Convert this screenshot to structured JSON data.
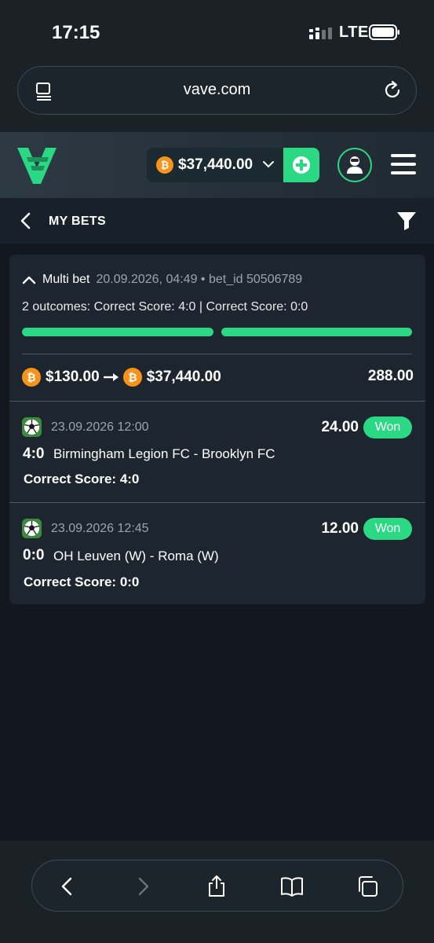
{
  "status_bar": {
    "time": "17:15",
    "network": "LTE",
    "icons": [
      "signal-icon",
      "battery-icon"
    ]
  },
  "browser": {
    "url": "vave.com",
    "icons": [
      "reader-icon",
      "reload-icon"
    ],
    "toolbar_icons": [
      "back-icon",
      "forward-icon",
      "share-icon",
      "bookmarks-icon",
      "tabs-icon"
    ]
  },
  "header": {
    "balance": "$37,440.00",
    "icons": [
      "vave-logo-icon",
      "bitcoin-icon",
      "chevron-down-icon",
      "plus-icon",
      "user-icon",
      "menu-icon"
    ]
  },
  "subheader": {
    "title": "MY BETS",
    "icons": [
      "chevron-left-icon",
      "filter-icon"
    ]
  },
  "bet": {
    "type": "Multi bet",
    "meta": "20.09.2026, 04:49 • bet_id 50506789",
    "outcomes": "2 outcomes: Correct Score: 4:0 | Correct Score: 0:0",
    "legs_won": 2,
    "legs_total": 2,
    "stake": "$130.00",
    "payout": "$37,440.00",
    "total_odds": "288.00",
    "legs": [
      {
        "datetime": "23.09.2026 12:00",
        "odds": "24.00",
        "status": "Won",
        "score": "4:0",
        "teams": "Birmingham Legion FC - Brooklyn FC",
        "selection": "Correct Score: 4:0"
      },
      {
        "datetime": "23.09.2026 12:45",
        "odds": "12.00",
        "status": "Won",
        "score": "0:0",
        "teams": "OH Leuven (W) - Roma (W)",
        "selection": "Correct Score: 0:0"
      }
    ]
  },
  "colors": {
    "accent": "#2bd884",
    "bitcoin": "#f7931a",
    "background": "#111820",
    "card": "#1d262e"
  }
}
